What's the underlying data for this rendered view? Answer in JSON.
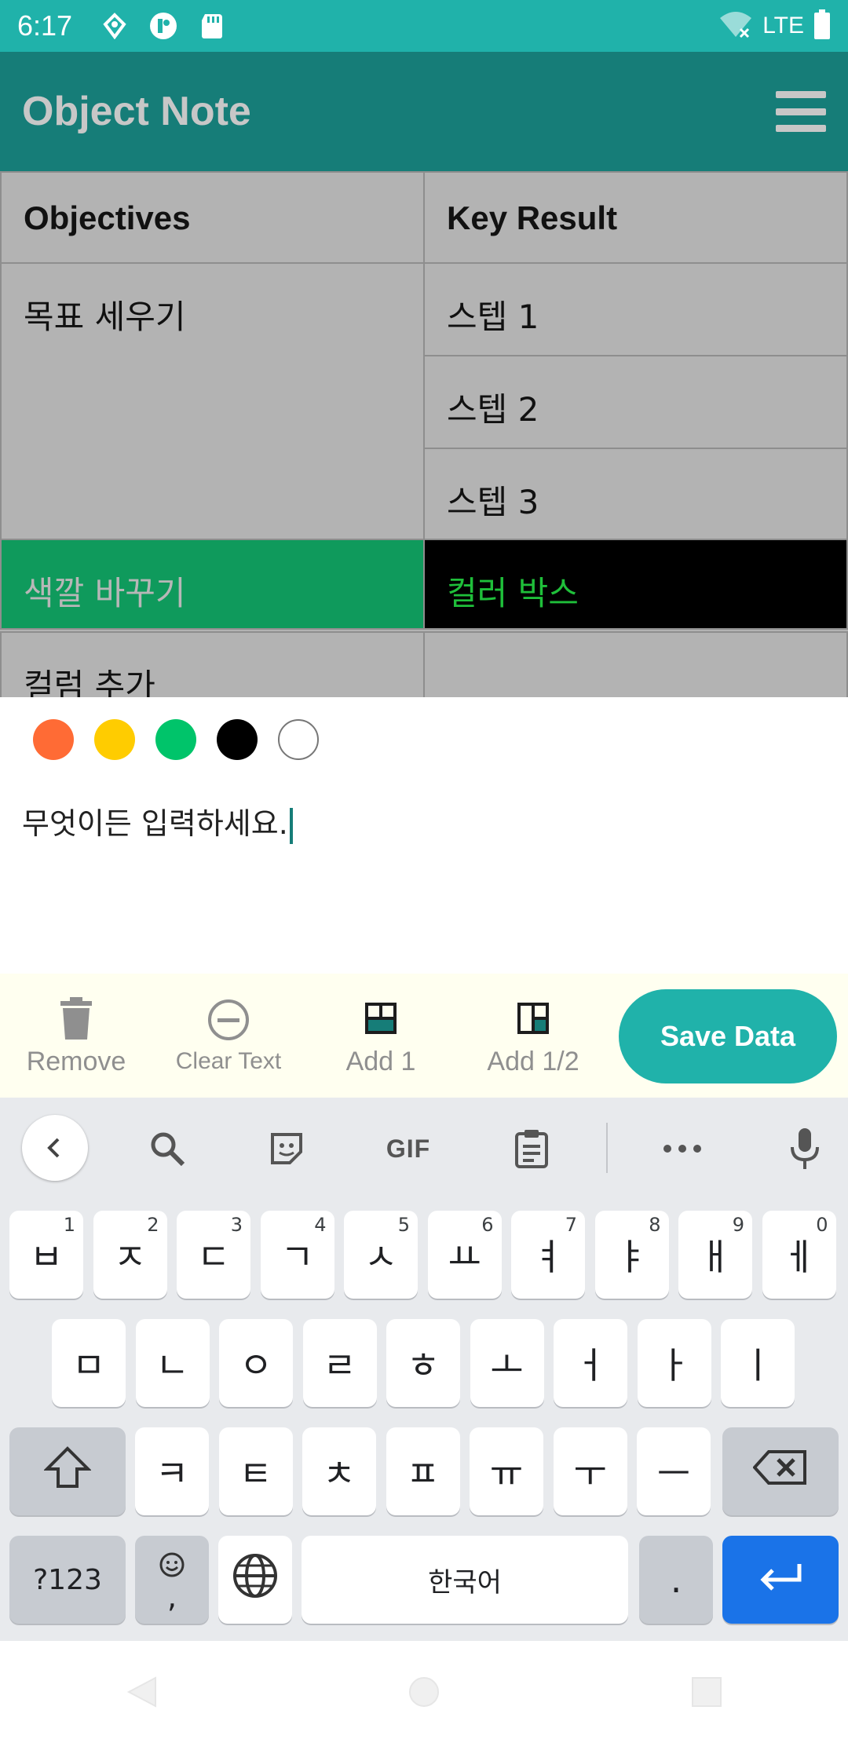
{
  "status": {
    "time": "6:17",
    "network": "LTE"
  },
  "app": {
    "title": "Object Note"
  },
  "table": {
    "headers": {
      "objectives": "Objectives",
      "key_result": "Key Result"
    },
    "rows": {
      "obj1": "목표 세우기",
      "kr1": "스텝 1",
      "kr2": "스텝 2",
      "kr3": "스텝 3",
      "obj2": "색깔 바꾸기",
      "kr4": "컬러 박스",
      "obj3": "컬럼 추가",
      "kr5": ""
    }
  },
  "colors": [
    "#ff6b35",
    "#ffcc00",
    "#00c46a",
    "#000000",
    "#ffffff"
  ],
  "editor": {
    "placeholder": "무엇이든 입력하세요."
  },
  "toolbar": {
    "remove": "Remove",
    "clear": "Clear Text",
    "add1": "Add 1",
    "add_half": "Add 1/2",
    "save": "Save Data"
  },
  "keyboard": {
    "row1": [
      {
        "k": "ㅂ",
        "n": "1"
      },
      {
        "k": "ㅈ",
        "n": "2"
      },
      {
        "k": "ㄷ",
        "n": "3"
      },
      {
        "k": "ㄱ",
        "n": "4"
      },
      {
        "k": "ㅅ",
        "n": "5"
      },
      {
        "k": "ㅛ",
        "n": "6"
      },
      {
        "k": "ㅕ",
        "n": "7"
      },
      {
        "k": "ㅑ",
        "n": "8"
      },
      {
        "k": "ㅐ",
        "n": "9"
      },
      {
        "k": "ㅔ",
        "n": "0"
      }
    ],
    "row2": [
      "ㅁ",
      "ㄴ",
      "ㅇ",
      "ㄹ",
      "ㅎ",
      "ㅗ",
      "ㅓ",
      "ㅏ",
      "ㅣ"
    ],
    "row3": [
      "ㅋ",
      "ㅌ",
      "ㅊ",
      "ㅍ",
      "ㅠ",
      "ㅜ",
      "ㅡ"
    ],
    "sym": "?123",
    "space": "한국어",
    "period": ".",
    "comma": ",",
    "gif": "GIF"
  }
}
